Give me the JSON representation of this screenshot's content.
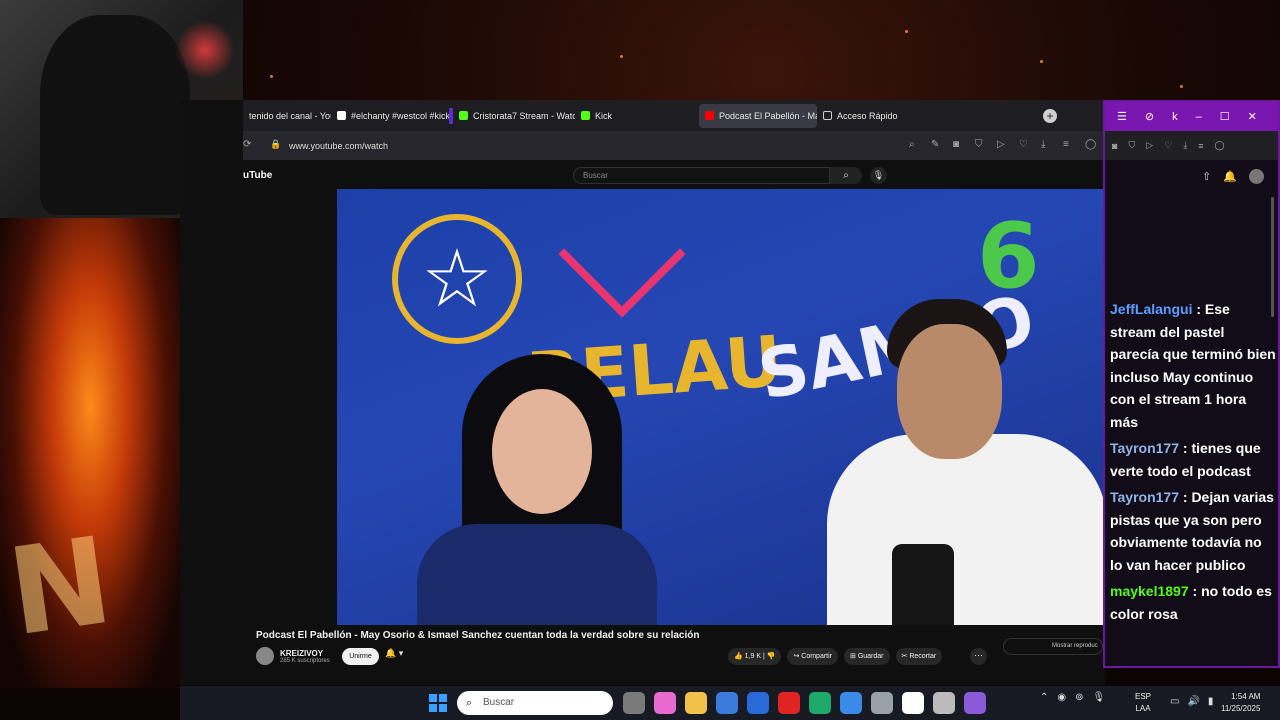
{
  "browser": {
    "tabs": [
      {
        "label": "tenido del canal - You",
        "fav_color": "#ff0000"
      },
      {
        "label": "#elchanty #westcol #kick",
        "fav_color": "#ffffff"
      },
      {
        "label": "Cristorata7 Stream - Watc",
        "fav_color": "#53fc18"
      },
      {
        "label": "Kick",
        "fav_color": "#53fc18"
      },
      {
        "label": "Podcast El Pabellón - May",
        "fav_color": "#ff0000"
      },
      {
        "label": "Acceso Rápido",
        "fav_color": "#cccccc"
      }
    ],
    "new_tab_label": "+",
    "url": "www.youtube.com/watch"
  },
  "youtube": {
    "logo_text": "uTube",
    "search_placeholder": "Buscar",
    "video": {
      "overlay_word1": "RELAU",
      "overlay_word2": "SAMBO",
      "overlay_num": "6",
      "title": "Podcast El Pabellón - May Osorio & Ismael Sanchez cuentan toda la verdad sobre su relación",
      "channel_name": "KREIZIVOY",
      "subscribers": "285 K suscriptores",
      "join_label": "Unirme",
      "likes": "1,9 K",
      "share_label": "Compartir",
      "save_label": "Guardar",
      "clip_label": "Recortar",
      "autoplay_label": "Mostrar reproduc"
    }
  },
  "chat": {
    "titlebar_letter": "k",
    "messages": [
      {
        "user": "JeffLalangui",
        "color": "#5aa0ff",
        "text": ": Ese stream del pastel parecía que terminó bien incluso May continuo con el stream 1 hora más"
      },
      {
        "user": "Tayron177",
        "color": "#8fb4e8",
        "text": ": tienes que verte todo el podcast"
      },
      {
        "user": "Tayron177",
        "color": "#8fb4e8",
        "text": ": Dejan varias pistas que ya son pero obviamente todavía no lo van hacer publico"
      },
      {
        "user": "maykel1897",
        "color": "#53fc18",
        "text": ": no todo es color rosa"
      }
    ]
  },
  "taskbar": {
    "search_placeholder": "Buscar",
    "lang_top": "ESP",
    "lang_bottom": "LAA",
    "time": "1:54 AM",
    "date": "11/25/2025",
    "icon_colors": [
      "#7a7a7a",
      "#e86ad0",
      "#f2c14a",
      "#3a7ad8",
      "#2a6ad8",
      "#e02424",
      "#1ea86a",
      "#3a8ae8",
      "#9aa0a8",
      "#ffffff",
      "#bbbbbb",
      "#8a5ad8"
    ]
  }
}
